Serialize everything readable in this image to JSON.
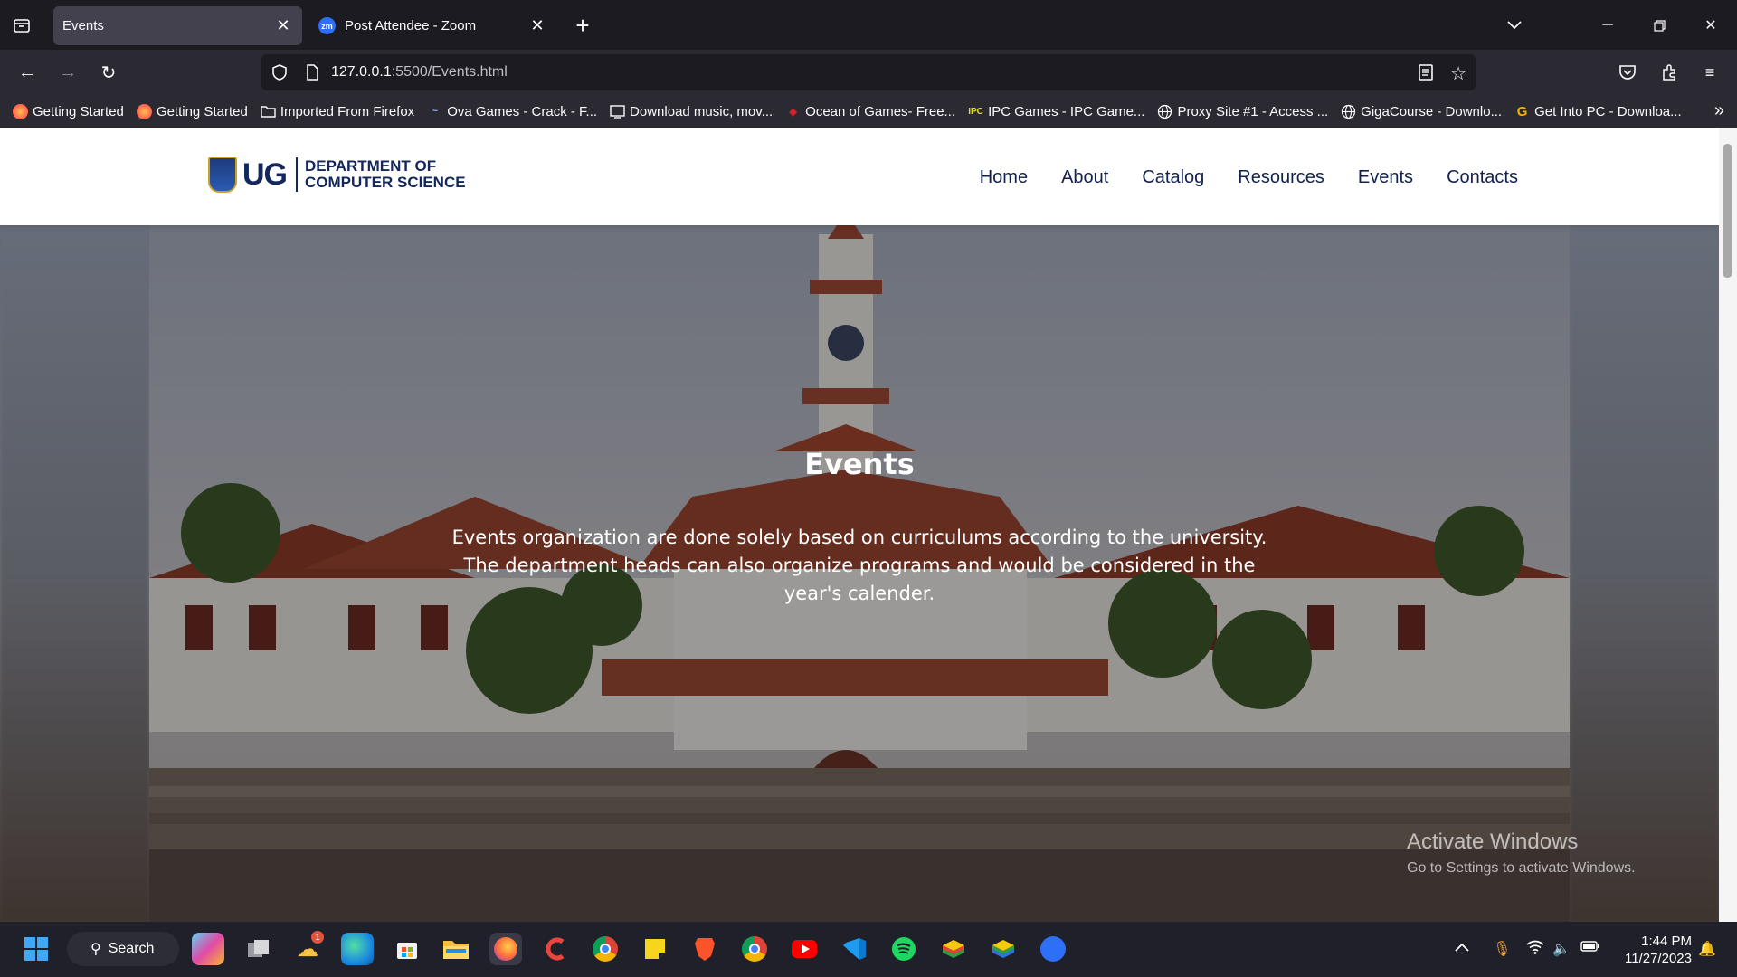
{
  "browser": {
    "tabs": [
      {
        "title": "Events",
        "active": true
      },
      {
        "title": "Post Attendee - Zoom",
        "active": false,
        "favicon_text": "zm"
      }
    ],
    "url_host": "127.0.0.1",
    "url_path": ":5500/Events.html",
    "bookmarks": [
      {
        "label": "Getting Started",
        "icon": "firefox-icon"
      },
      {
        "label": "Getting Started",
        "icon": "firefox-icon"
      },
      {
        "label": "Imported From Firefox",
        "icon": "folder-icon"
      },
      {
        "label": "Ova Games - Crack - F...",
        "icon": "ova-icon"
      },
      {
        "label": "Download music, mov...",
        "icon": "download-site-icon"
      },
      {
        "label": "Ocean of Games- Free...",
        "icon": "ocean-games-icon"
      },
      {
        "label": "IPC Games - IPC Game...",
        "icon": "ipc-icon"
      },
      {
        "label": "Proxy Site #1 - Access ...",
        "icon": "globe-icon"
      },
      {
        "label": "GigaCourse - Downlo...",
        "icon": "globe-icon"
      },
      {
        "label": "Get Into PC - Downloa...",
        "icon": "getintopc-icon"
      }
    ]
  },
  "site": {
    "logo_mark": "UG",
    "logo_line1": "DEPARTMENT OF",
    "logo_line2": "COMPUTER SCIENCE",
    "nav": [
      "Home",
      "About",
      "Catalog",
      "Resources",
      "Events",
      "Contacts"
    ],
    "hero_title": "Events",
    "hero_text": "Events organization are done solely based on curriculums according to the university. The department heads can also organize programs and would be considered in the year's calender."
  },
  "watermark": {
    "line1": "Activate Windows",
    "line2": "Go to Settings to activate Windows."
  },
  "taskbar": {
    "search_label": "Search",
    "time": "1:44 PM",
    "date": "11/27/2023",
    "weather_badge": "1"
  },
  "colors": {
    "nav_text": "#12214e",
    "logo_blue": "#13275c",
    "browser_bg": "#1c1b22",
    "toolbar_bg": "#2b2a33"
  }
}
